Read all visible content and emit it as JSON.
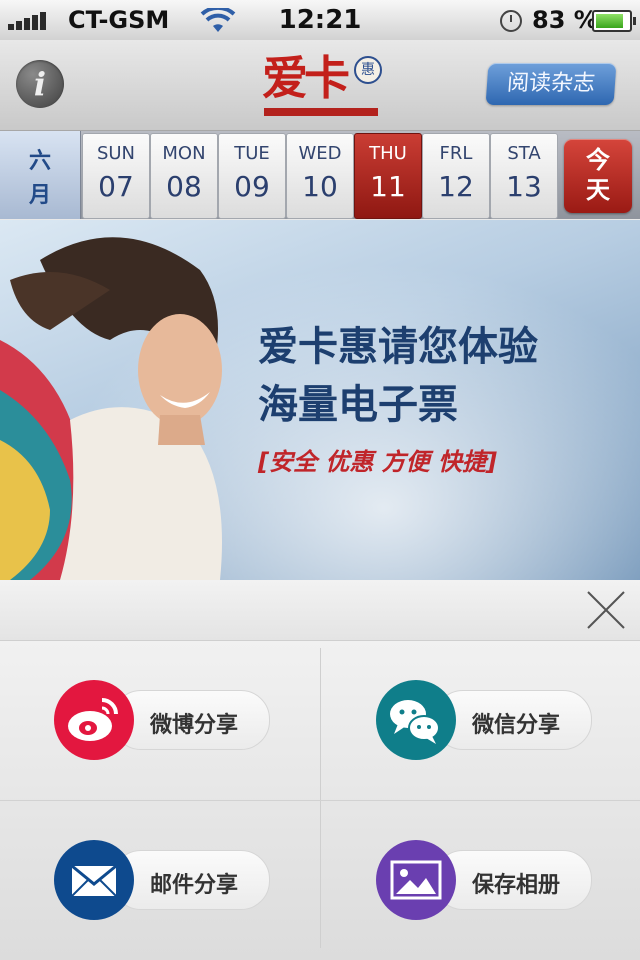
{
  "status_bar": {
    "carrier": "CT-GSM",
    "time": "12:21",
    "battery_percent": "83 %",
    "battery_level": 0.83
  },
  "header": {
    "info_icon": "i",
    "logo_text": "爱卡",
    "logo_badge": "惠",
    "magazine_button": "阅读杂志"
  },
  "calendar": {
    "month_label_line1": "六",
    "month_label_line2": "月",
    "days": [
      {
        "dow": "SUN",
        "num": "07"
      },
      {
        "dow": "MON",
        "num": "08"
      },
      {
        "dow": "TUE",
        "num": "09"
      },
      {
        "dow": "WED",
        "num": "10"
      },
      {
        "dow": "THU",
        "num": "11",
        "selected": true
      },
      {
        "dow": "FRL",
        "num": "12"
      },
      {
        "dow": "STA",
        "num": "13"
      }
    ],
    "today_line1": "今",
    "today_line2": "天"
  },
  "banner": {
    "headline_line1": "爱卡惠请您体验",
    "headline_line2": "海量电子票",
    "tagline": "[安全  优惠  方便  快捷]"
  },
  "share_sheet": {
    "close_icon": "close-icon",
    "options": [
      {
        "label": "微博分享",
        "icon": "weibo-icon",
        "color": "#e3173f"
      },
      {
        "label": "微信分享",
        "icon": "wechat-icon",
        "color": "#0f7e8a"
      },
      {
        "label": "邮件分享",
        "icon": "mail-icon",
        "color": "#0e4a8e"
      },
      {
        "label": "保存相册",
        "icon": "photo-album-icon",
        "color": "#6a3fb0"
      }
    ]
  },
  "colors": {
    "accent_red": "#c3201b",
    "calendar_blue": "#2d3f6a",
    "headline_blue": "#1d3f6f"
  }
}
